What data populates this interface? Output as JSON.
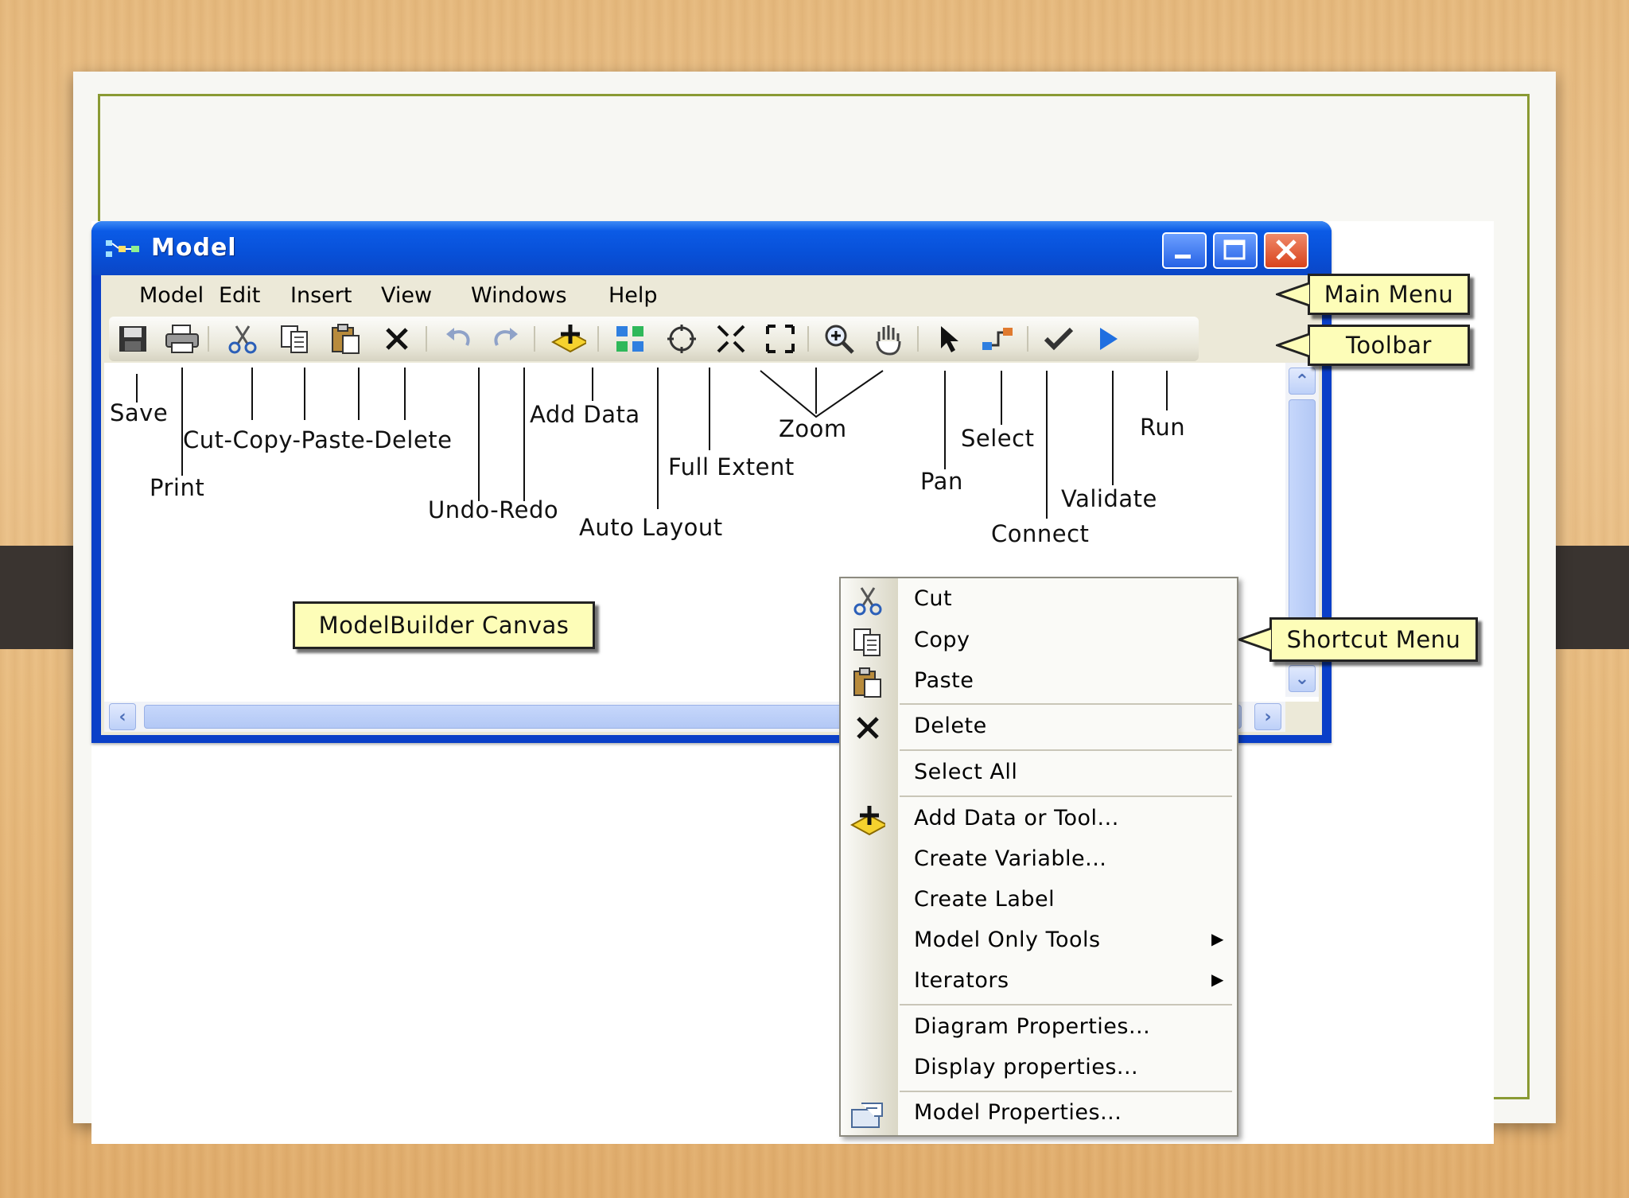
{
  "window": {
    "title": "Model",
    "menu": [
      "Model",
      "Edit",
      "Insert",
      "View",
      "Windows",
      "Help"
    ]
  },
  "toolbar_icons": [
    "save-icon",
    "print-icon",
    "cut-icon",
    "copy-icon",
    "paste-icon",
    "delete-icon",
    "undo-icon",
    "redo-icon",
    "add-data-icon",
    "auto-layout-icon",
    "full-extent-icon",
    "zoom-in-fixed-icon",
    "zoom-out-fixed-icon",
    "zoom-tool-icon",
    "pan-icon",
    "select-icon",
    "connect-icon",
    "validate-icon",
    "run-icon"
  ],
  "annotations": {
    "save": "Save",
    "print": "Print",
    "cut_copy_paste_delete": "Cut-Copy-Paste-Delete",
    "undo_redo": "Undo-Redo",
    "add_data": "Add Data",
    "auto_layout": "Auto Layout",
    "full_extent": "Full Extent",
    "zoom": "Zoom",
    "pan": "Pan",
    "select": "Select",
    "connect": "Connect",
    "validate": "Validate",
    "run": "Run"
  },
  "callouts": {
    "main_menu": "Main Menu",
    "toolbar": "Toolbar",
    "canvas": "ModelBuilder Canvas",
    "shortcut_menu": "Shortcut Menu"
  },
  "context_menu": {
    "cut": "Cut",
    "copy": "Copy",
    "paste": "Paste",
    "delete": "Delete",
    "select_all": "Select All",
    "add_data_or_tool": "Add Data or Tool...",
    "create_variable": "Create Variable...",
    "create_label": "Create Label",
    "model_only_tools": "Model Only Tools",
    "iterators": "Iterators",
    "diagram_properties": "Diagram Properties...",
    "display_properties": "Display properties...",
    "model_properties": "Model Properties..."
  },
  "colors": {
    "titlebar": "#0a55dc",
    "callout_fill": "#fdfdb8",
    "slide_border": "#8a9a33"
  }
}
